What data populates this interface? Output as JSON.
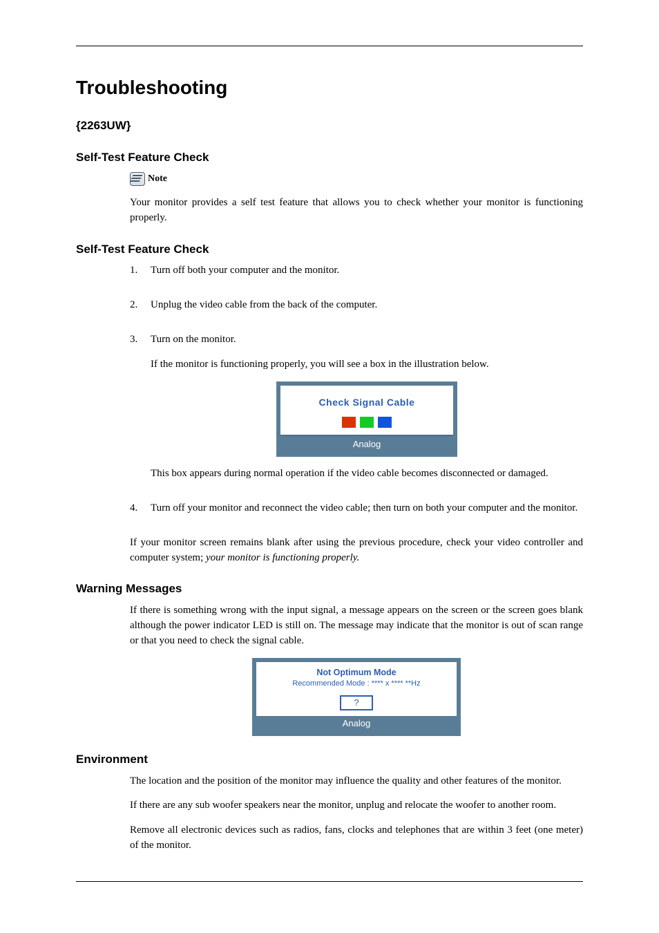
{
  "page": {
    "title": "Troubleshooting",
    "model": "{2263UW}",
    "note_label": "Note"
  },
  "s1": {
    "heading": "Self-Test Feature Check",
    "note_text": "Your monitor provides a self test feature that allows you to check whether your monitor is functioning properly."
  },
  "s2": {
    "heading": "Self-Test Feature Check",
    "steps": {
      "1": {
        "num": "1.",
        "text": "Turn off both your computer and the monitor."
      },
      "2": {
        "num": "2.",
        "text": "Unplug the video cable from the back of the computer."
      },
      "3": {
        "num": "3.",
        "text": "Turn on the monitor.",
        "extra1": "If the monitor is functioning properly, you will see a box in the illustration below.",
        "extra2": "This box appears during normal operation if the video cable becomes disconnected or damaged."
      },
      "4": {
        "num": "4.",
        "text": "Turn off your monitor and reconnect the video cable; then turn on both your computer and the monitor."
      }
    },
    "closing_plain": "If your monitor screen remains blank after using the previous procedure, check your video controller and computer system; ",
    "closing_italic": "your monitor is functioning properly."
  },
  "osd1": {
    "title": "Check Signal Cable",
    "footer": "Analog"
  },
  "s3": {
    "heading": "Warning Messages",
    "body": "If there is something wrong with the input signal, a message appears on the screen or the screen goes blank although the power indicator LED is still on. The message may indicate that the monitor is out of scan range or that you need to check the signal cable."
  },
  "osd2": {
    "line1": "Not Optimum Mode",
    "line2": "Recommended Mode : **** x ****  **Hz",
    "btn": "?",
    "footer": "Analog"
  },
  "s4": {
    "heading": "Environment",
    "p1": "The location and the position of the monitor may influence the quality and other features of the monitor.",
    "p2": "If there are any sub woofer speakers near the monitor, unplug and relocate the woofer to another room.",
    "p3": "Remove all electronic devices such as radios, fans, clocks and telephones that are within 3 feet (one meter) of the monitor."
  }
}
